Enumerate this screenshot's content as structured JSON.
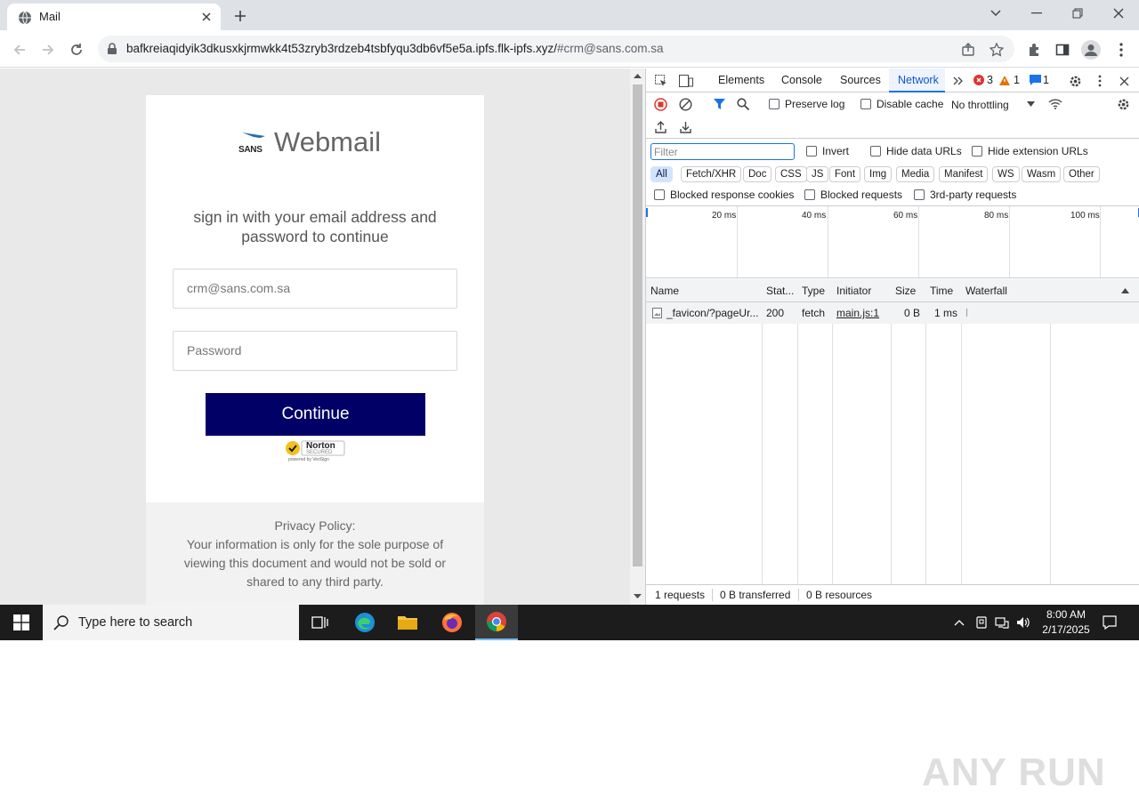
{
  "browser": {
    "tab_title": "Mail",
    "url_main": "bafkreiaqidyik3dkusxkjrmwkk4t53zryb3rdzeb4tsbfyqu3db6vf5e5a.ipfs.flk-ipfs.xyz/",
    "url_fragment": "#crm@sans.com.sa"
  },
  "page": {
    "logo_text": "SANS",
    "brand": "Webmail",
    "heading": "sign in with your email address and password to continue",
    "email_value": "crm@sans.com.sa",
    "password_placeholder": "Password",
    "continue_label": "Continue",
    "norton_text": "Norton",
    "norton_sub": "SECURED",
    "norton_powered": "powered by VeriSign",
    "privacy_title": "Privacy Policy:",
    "privacy_text": "Your information is only for the sole purpose of viewing this document and would not be sold or shared to any third party."
  },
  "devtools": {
    "tabs": [
      "Elements",
      "Console",
      "Sources",
      "Network"
    ],
    "errors": "3",
    "warnings": "1",
    "messages": "1",
    "preserve_log": "Preserve log",
    "disable_cache": "Disable cache",
    "throttling": "No throttling",
    "filter_placeholder": "Filter",
    "invert": "Invert",
    "hide_data_urls": "Hide data URLs",
    "hide_extension_urls": "Hide extension URLs",
    "type_filters": [
      "All",
      "Fetch/XHR",
      "Doc",
      "CSS",
      "JS",
      "Font",
      "Img",
      "Media",
      "Manifest",
      "WS",
      "Wasm",
      "Other"
    ],
    "blocked_response_cookies": "Blocked response cookies",
    "blocked_requests": "Blocked requests",
    "third_party_requests": "3rd-party requests",
    "timeline_labels": [
      "20 ms",
      "40 ms",
      "60 ms",
      "80 ms",
      "100 ms"
    ],
    "columns": [
      "Name",
      "Stat...",
      "Type",
      "Initiator",
      "Size",
      "Time",
      "Waterfall"
    ],
    "rows": [
      {
        "name": "_favicon/?pageUr...",
        "status": "200",
        "type": "fetch",
        "initiator": "main.js:1",
        "size": "0 B",
        "time": "1 ms"
      }
    ],
    "status_requests": "1 requests",
    "status_transferred": "0 B transferred",
    "status_resources": "0 B resources"
  },
  "watermark": "ANY RUN",
  "taskbar": {
    "search_text": "Type here to search",
    "time": "8:00 AM",
    "date": "2/17/2025"
  }
}
